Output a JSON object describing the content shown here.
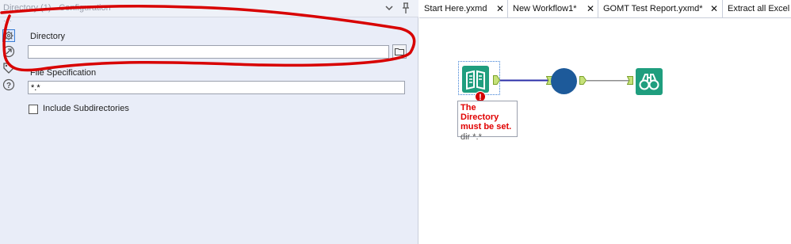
{
  "config_panel": {
    "title": "Directory (1) - Configuration",
    "side_icons": [
      "gear-icon",
      "connection-icon",
      "tag-icon",
      "help-icon"
    ],
    "directory": {
      "label": "Directory",
      "value": ""
    },
    "file_spec": {
      "label": "File Specification",
      "value": "*.*"
    },
    "include_subdirs": {
      "label": "Include Subdirectories",
      "checked": false
    }
  },
  "tabs": [
    {
      "label": "Start Here.yxmd",
      "closable": true
    },
    {
      "label": "New Workflow1*",
      "closable": true
    },
    {
      "label": "GOMT Test Report.yxmd*",
      "closable": true
    },
    {
      "label": "Extract all Excel t",
      "closable": false
    }
  ],
  "tab_close_glyph": "✕",
  "canvas": {
    "error_glyph": "!",
    "annotation": {
      "error": "The Directory must be set.",
      "note": "dir *.*"
    },
    "colors": {
      "directory_tool": "#1f9e7e",
      "circle_tool": "#1d5a9a",
      "browse_tool": "#1f9e7e",
      "connector_active": "#2b2fa8",
      "connector_inactive": "#8e8e8e",
      "error": "#e00000",
      "annotation_stroke": "#e00000"
    }
  }
}
